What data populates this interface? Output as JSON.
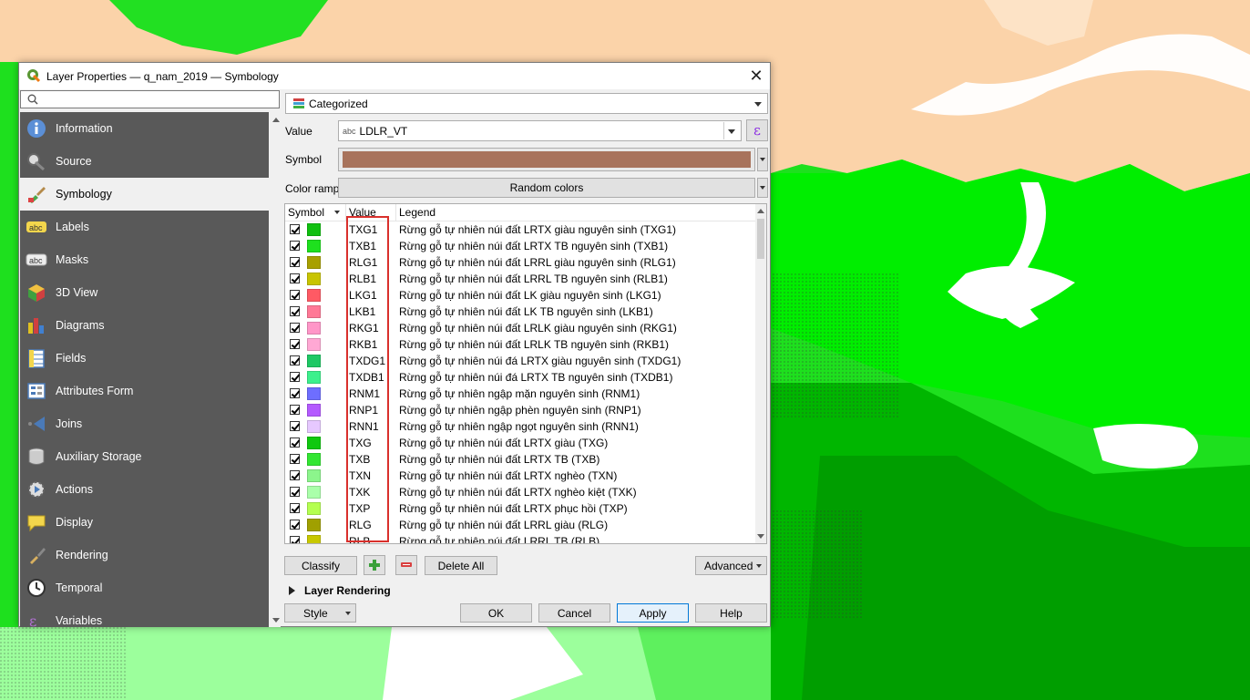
{
  "window": {
    "title": "Layer Properties — q_nam_2019 — Symbology",
    "close_symbol": "✕"
  },
  "search": {
    "placeholder": ""
  },
  "sidebar": {
    "items": [
      {
        "label": "Information",
        "icon": "information-icon"
      },
      {
        "label": "Source",
        "icon": "source-icon"
      },
      {
        "label": "Symbology",
        "icon": "symbology-icon",
        "active": true
      },
      {
        "label": "Labels",
        "icon": "labels-icon"
      },
      {
        "label": "Masks",
        "icon": "masks-icon"
      },
      {
        "label": "3D View",
        "icon": "3d-view-icon"
      },
      {
        "label": "Diagrams",
        "icon": "diagrams-icon"
      },
      {
        "label": "Fields",
        "icon": "fields-icon"
      },
      {
        "label": "Attributes Form",
        "icon": "attributes-form-icon"
      },
      {
        "label": "Joins",
        "icon": "joins-icon"
      },
      {
        "label": "Auxiliary Storage",
        "icon": "auxiliary-storage-icon"
      },
      {
        "label": "Actions",
        "icon": "actions-icon"
      },
      {
        "label": "Display",
        "icon": "display-icon"
      },
      {
        "label": "Rendering",
        "icon": "rendering-icon"
      },
      {
        "label": "Temporal",
        "icon": "temporal-icon"
      },
      {
        "label": "Variables",
        "icon": "variables-icon"
      }
    ]
  },
  "renderer": {
    "type": "Categorized"
  },
  "value_field": {
    "label": "Value",
    "type_badge": "abc",
    "value": "LDLR_VT",
    "expression_symbol": "ε"
  },
  "symbol": {
    "label": "Symbol",
    "color": "#a8735c"
  },
  "color_ramp": {
    "label": "Color ramp",
    "value": "Random colors"
  },
  "table": {
    "headers": [
      "Symbol",
      "Value",
      "Legend"
    ],
    "rows": [
      {
        "value": "TXG1",
        "legend": "Rừng gỗ tự nhiên núi đất LRTX giàu nguyên sinh (TXG1)",
        "color": "#0fbf0f"
      },
      {
        "value": "TXB1",
        "legend": "Rừng gỗ tự nhiên núi đất LRTX TB nguyên sinh (TXB1)",
        "color": "#1ee01e"
      },
      {
        "value": "RLG1",
        "legend": "Rừng gỗ tự nhiên núi đất LRRL giàu nguyên sinh (RLG1)",
        "color": "#a8a000"
      },
      {
        "value": "RLB1",
        "legend": "Rừng gỗ tự nhiên núi đất LRRL TB nguyên sinh (RLB1)",
        "color": "#c8c400"
      },
      {
        "value": "LKG1",
        "legend": "Rừng gỗ tự nhiên núi đất LK giàu nguyên sinh (LKG1)",
        "color": "#ff5a64"
      },
      {
        "value": "LKB1",
        "legend": "Rừng gỗ tự nhiên núi đất LK TB nguyên sinh (LKB1)",
        "color": "#ff7896"
      },
      {
        "value": "RKG1",
        "legend": "Rừng gỗ tự nhiên núi đất LRLK giàu nguyên sinh (RKG1)",
        "color": "#ff96c8"
      },
      {
        "value": "RKB1",
        "legend": "Rừng gỗ tự nhiên núi đất LRLK TB nguyên sinh (RKB1)",
        "color": "#ffa8d4"
      },
      {
        "value": "TXDG1",
        "legend": "Rừng gỗ tự nhiên núi đá LRTX giàu nguyên sinh (TXDG1)",
        "color": "#1ec864"
      },
      {
        "value": "TXDB1",
        "legend": "Rừng gỗ tự nhiên núi đá LRTX TB nguyên sinh (TXDB1)",
        "color": "#3cf08c"
      },
      {
        "value": "RNM1",
        "legend": "Rừng gỗ tự nhiên ngập mặn nguyên sinh (RNM1)",
        "color": "#6e6eff"
      },
      {
        "value": "RNP1",
        "legend": "Rừng gỗ tự nhiên ngập phèn nguyên sinh (RNP1)",
        "color": "#b45aff"
      },
      {
        "value": "RNN1",
        "legend": "Rừng gỗ tự nhiên ngập ngọt nguyên sinh (RNN1)",
        "color": "#e6c8ff"
      },
      {
        "value": "TXG",
        "legend": "Rừng gỗ tự nhiên núi đất LRTX giàu (TXG)",
        "color": "#0fc80f"
      },
      {
        "value": "TXB",
        "legend": "Rừng gỗ tự nhiên núi đất LRTX TB (TXB)",
        "color": "#32e632"
      },
      {
        "value": "TXN",
        "legend": "Rừng gỗ tự nhiên núi đất LRTX nghèo (TXN)",
        "color": "#8cf58c"
      },
      {
        "value": "TXK",
        "legend": "Rừng gỗ tự nhiên núi đất LRTX nghèo kiệt (TXK)",
        "color": "#aaffaa"
      },
      {
        "value": "TXP",
        "legend": "Rừng gỗ tự nhiên núi đất LRTX phục hồi (TXP)",
        "color": "#b4ff50"
      },
      {
        "value": "RLG",
        "legend": "Rừng gỗ tự nhiên núi đất LRRL giàu (RLG)",
        "color": "#a0a000"
      },
      {
        "value": "RLB",
        "legend": "Rừng gỗ tự nhiên núi đất LRRL TB (RLB)",
        "color": "#c8c800"
      }
    ]
  },
  "actions": {
    "classify": "Classify",
    "delete_all": "Delete All",
    "advanced": "Advanced"
  },
  "layer_rendering": {
    "label": "Layer Rendering"
  },
  "footer": {
    "style": "Style",
    "ok": "OK",
    "cancel": "Cancel",
    "apply": "Apply",
    "help": "Help"
  }
}
